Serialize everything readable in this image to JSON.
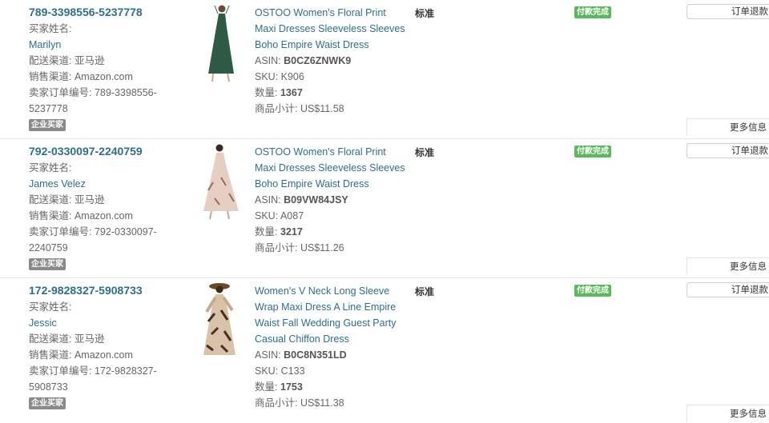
{
  "orders": [
    {
      "order_id": "789-3398556-5237778",
      "buyer_label": "买家姓名:",
      "buyer_name": "Marilyn",
      "ship_channel": "配送渠道: 亚马逊",
      "sales_channel": "销售渠道: Amazon.com",
      "seller_order_line1": "卖家订单编号: 789-3398556-",
      "seller_order_line2": "5237778",
      "biz_badge": "企业买家",
      "title_lines": [
        "OSTOO Women's Floral Print",
        "Maxi Dresses Sleeveless Sleeves",
        "Boho Empire Waist Dress"
      ],
      "asin_label": "ASIN:",
      "asin": "B0CZ6ZNWK9",
      "sku": "SKU: K906",
      "qty_label": "数量:",
      "qty": "1367",
      "subtotal": "商品小计: US$11.58",
      "ship_type": "标准",
      "status": "付款完成",
      "refund_button": "订单退款",
      "more_info": "更多信息",
      "image_color": "#2f5a45"
    },
    {
      "order_id": "792-0330097-2240759",
      "buyer_label": "买家姓名:",
      "buyer_name": "James Velez",
      "ship_channel": "配送渠道: 亚马逊",
      "sales_channel": "销售渠道: Amazon.com",
      "seller_order_line1": "卖家订单编号: 792-0330097-",
      "seller_order_line2": "2240759",
      "biz_badge": "企业买家",
      "title_lines": [
        "OSTOO Women's Floral Print",
        "Maxi Dresses Sleeveless Sleeves",
        "Boho Empire Waist Dress"
      ],
      "asin_label": "ASIN:",
      "asin": "B09VW84JSY",
      "sku": "SKU: A087",
      "qty_label": "数量:",
      "qty": "3217",
      "subtotal": "商品小计: US$11.26",
      "ship_type": "标准",
      "status": "付款完成",
      "refund_button": "订单退款",
      "more_info": "更多信息",
      "image_color": "#d9b8a8"
    },
    {
      "order_id": "172-9828327-5908733",
      "buyer_label": "买家姓名:",
      "buyer_name": "Jessic",
      "ship_channel": "配送渠道: 亚马逊",
      "sales_channel": "销售渠道: Amazon.com",
      "seller_order_line1": "卖家订单编号: 172-9828327-",
      "seller_order_line2": "5908733",
      "biz_badge": "企业买家",
      "title_lines": [
        "Women's V Neck Long Sleeve",
        "Wrap Maxi Dress A Line Empire",
        "Waist Fall Wedding Guest Party",
        "Casual Chiffon Dress"
      ],
      "asin_label": "ASIN:",
      "asin": "B0C8N351LD",
      "sku": "SKU: C133",
      "qty_label": "数量:",
      "qty": "1753",
      "subtotal": "商品小计: US$11.38",
      "ship_type": "标准",
      "status": "付款完成",
      "refund_button": "订单退款",
      "more_info": "更多信息",
      "image_color": "#5a3b2b"
    }
  ]
}
